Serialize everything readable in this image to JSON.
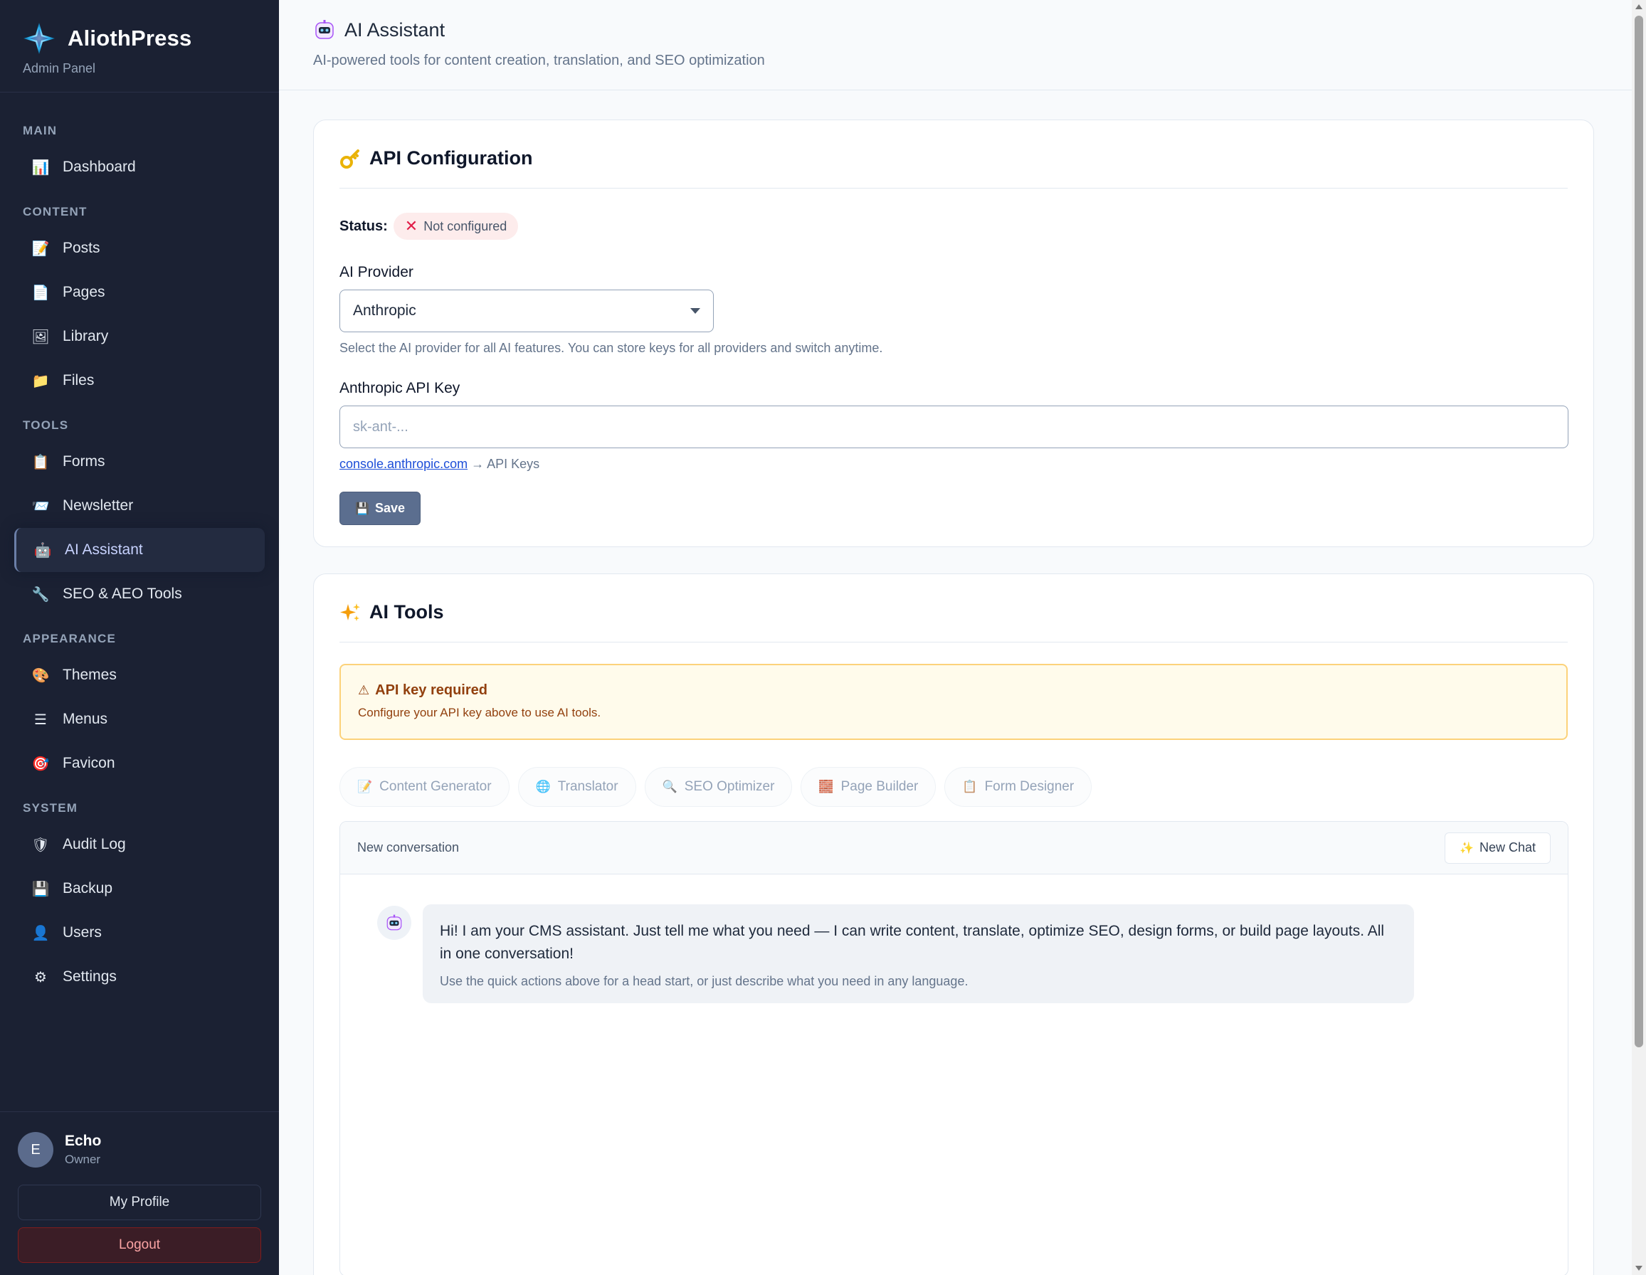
{
  "brand": {
    "name": "AliothPress",
    "subtitle": "Admin Panel"
  },
  "sidebar": {
    "sections": [
      {
        "heading": "MAIN",
        "items": [
          {
            "label": "Dashboard",
            "icon": "chart-icon"
          }
        ]
      },
      {
        "heading": "CONTENT",
        "items": [
          {
            "label": "Posts",
            "icon": "posts-icon"
          },
          {
            "label": "Pages",
            "icon": "page-icon"
          },
          {
            "label": "Library",
            "icon": "image-icon"
          },
          {
            "label": "Files",
            "icon": "folder-icon"
          }
        ]
      },
      {
        "heading": "TOOLS",
        "items": [
          {
            "label": "Forms",
            "icon": "clipboard-icon"
          },
          {
            "label": "Newsletter",
            "icon": "newsletter-icon"
          },
          {
            "label": "AI Assistant",
            "icon": "robot-icon",
            "active": true
          },
          {
            "label": "SEO & AEO Tools",
            "icon": "wrench-icon"
          }
        ]
      },
      {
        "heading": "APPEARANCE",
        "items": [
          {
            "label": "Themes",
            "icon": "palette-icon"
          },
          {
            "label": "Menus",
            "icon": "menu-icon"
          },
          {
            "label": "Favicon",
            "icon": "target-icon"
          }
        ]
      },
      {
        "heading": "SYSTEM",
        "items": [
          {
            "label": "Audit Log",
            "icon": "shield-icon"
          },
          {
            "label": "Backup",
            "icon": "floppy-icon"
          },
          {
            "label": "Users",
            "icon": "user-icon"
          },
          {
            "label": "Settings",
            "icon": "gear-icon"
          }
        ]
      }
    ]
  },
  "user": {
    "initial": "E",
    "name": "Echo",
    "role": "Owner",
    "profile_label": "My Profile",
    "logout_label": "Logout"
  },
  "header": {
    "title": "AI Assistant",
    "subtitle": "AI-powered tools for content creation, translation, and SEO optimization"
  },
  "api_config": {
    "title": "API Configuration",
    "status_label": "Status:",
    "status_value": "Not configured",
    "provider_label": "AI Provider",
    "provider_value": "Anthropic",
    "provider_help": "Select the AI provider for all AI features. You can store keys for all providers and switch anytime.",
    "key_label": "Anthropic API Key",
    "key_placeholder": "sk-ant-...",
    "key_value": "",
    "console_link": "console.anthropic.com",
    "console_suffix": "→ API Keys",
    "save_label": "Save"
  },
  "ai_tools": {
    "title": "AI Tools",
    "alert_title": "API key required",
    "alert_text": "Configure your API key above to use AI tools.",
    "tabs": [
      {
        "label": "Content Generator",
        "icon": "memo-icon"
      },
      {
        "label": "Translator",
        "icon": "globe-icon"
      },
      {
        "label": "SEO Optimizer",
        "icon": "magnifier-icon"
      },
      {
        "label": "Page Builder",
        "icon": "bricks-icon"
      },
      {
        "label": "Form Designer",
        "icon": "clipboard-icon"
      }
    ],
    "chat": {
      "title": "New conversation",
      "new_chat_label": "New Chat",
      "message": "Hi! I am your CMS assistant. Just tell me what you need — I can write content, translate, optimize SEO, design forms, or build page layouts. All in one conversation!",
      "message_hint": "Use the quick actions above for a head start, or just describe what you need in any language."
    }
  },
  "colors": {
    "sidebar_bg": "#1b2133",
    "accent": "#5b6e8f",
    "warning": "#92400e",
    "danger": "#e11d48"
  }
}
